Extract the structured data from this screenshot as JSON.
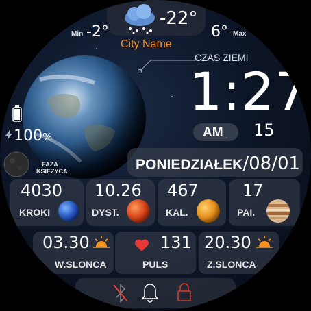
{
  "weather": {
    "icon": "snow-cloud-icon",
    "current_temp": "-22°",
    "min_label": "Min",
    "min_temp": "-2°",
    "max_label": "Max",
    "max_temp": "6°",
    "city": "City Name"
  },
  "time": {
    "caption": "CZAS ZIEMI",
    "hours": "1",
    "colon": ":",
    "minutes": "27",
    "ampm": "AM",
    "seconds": "15"
  },
  "battery": {
    "percent": "100",
    "percent_sign": "%",
    "level": 1.0
  },
  "moon": {
    "label_line1": "FAZA",
    "label_line2": "KSIEZYCA"
  },
  "date": {
    "weekday": "PONIEDZIAŁEK",
    "slash": "/",
    "date": "08/01"
  },
  "stats": [
    {
      "value": "4030",
      "label": "KROKI",
      "planet": "neptune-icon"
    },
    {
      "value": "10.26",
      "label": "DYST.",
      "planet": "mars-icon"
    },
    {
      "value": "467",
      "label": "KAL.",
      "planet": "venus-icon"
    },
    {
      "value": "17",
      "label": "PAI.",
      "planet": "jupiter-icon"
    }
  ],
  "bottom": {
    "sunrise_time": "03.30",
    "sunrise_label": "W.SLONCA",
    "pulse_value": "131",
    "pulse_label": "PULS",
    "sunset_time": "20.30",
    "sunset_label": "Z.SLONCA"
  },
  "colors": {
    "accent_orange": "#f7931e",
    "city_orange": "#ff8c1a",
    "heart_red": "#e53935",
    "lock_red": "#c0392b"
  },
  "status_icons": [
    "bluetooth-disabled-icon",
    "bell-icon",
    "lock-icon"
  ]
}
